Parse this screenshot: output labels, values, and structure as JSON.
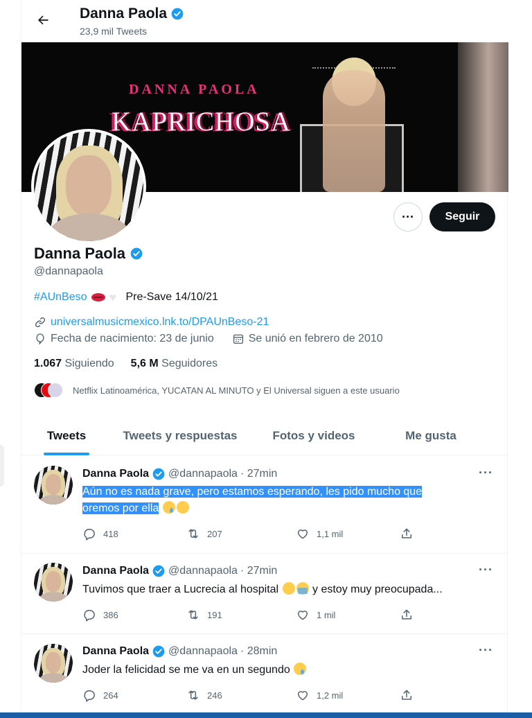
{
  "header": {
    "name": "Danna Paola",
    "tweet_count": "23,9 mil Tweets"
  },
  "banner": {
    "subtitle": "DANNA PAOLA",
    "title": "KAPRICHOSA"
  },
  "profile": {
    "name": "Danna Paola",
    "handle": "@dannapaola",
    "bio_hashtag": "#AUnBeso",
    "bio_rest": "Pre-Save 14/10/21",
    "link": "universalmusicmexico.lnk.to/DPAUnBeso-21",
    "birthday": "Fecha de nacimiento: 23 de junio",
    "joined": "Se unió en febrero de 2010",
    "following_count": "1.067",
    "following_label": "Siguiendo",
    "followers_count": "5,6 M",
    "followers_label": "Seguidores",
    "known_followers": "Netflix Latinoamérica, YUCATAN AL MINUTO y El Universal siguen a este usuario",
    "more_label": "···",
    "follow_label": "Seguir"
  },
  "tabs": [
    {
      "label": "Tweets",
      "active": true
    },
    {
      "label": "Tweets y respuestas",
      "active": false
    },
    {
      "label": "Fotos y videos",
      "active": false
    },
    {
      "label": "Me gusta",
      "active": false
    }
  ],
  "tweets": [
    {
      "name": "Danna Paola",
      "handle": "@dannapaola",
      "time": "· 27min",
      "text_line1": "Aún no es nada grave, pero estamos esperando, les pido mucho que",
      "text_line2": "oremos por ella",
      "replies": "418",
      "retweets": "207",
      "likes": "1,1 mil"
    },
    {
      "name": "Danna Paola",
      "handle": "@dannapaola",
      "time": "· 27min",
      "text_a": "Tuvimos que traer a Lucrecia al hospital",
      "text_b": "y estoy muy preocupada...",
      "replies": "386",
      "retweets": "191",
      "likes": "1 mil"
    },
    {
      "name": "Danna Paola",
      "handle": "@dannapaola",
      "time": "· 28min",
      "text": "Joder la felicidad se me va en un segundo",
      "replies": "264",
      "retweets": "246",
      "likes": "1,2 mil"
    }
  ],
  "colors": {
    "accent": "#1d9bf0",
    "text": "#0f1419",
    "muted": "#536471",
    "selection": "#3390ff"
  }
}
